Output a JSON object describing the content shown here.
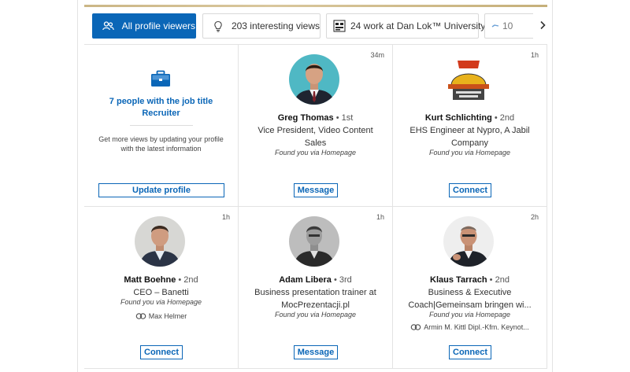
{
  "filters": [
    {
      "label": "All profile viewers",
      "icon": "people-icon",
      "active": true
    },
    {
      "label": "203 interesting views",
      "icon": "lightbulb-icon",
      "active": false
    },
    {
      "label": "24 work at Dan Lok™ University",
      "icon": "company-logo-icon",
      "active": false
    },
    {
      "label": "10",
      "icon": "chip-icon",
      "active": false
    }
  ],
  "filters_next_icon": "chevron-right-icon",
  "promo": {
    "title": "7 people with the job title Recruiter",
    "text": "Get more views by updating your profile with the latest information",
    "button": "Update profile",
    "icon": "briefcase-icon"
  },
  "viewers": [
    {
      "name": "Greg Thomas",
      "degree": "• 1st",
      "headline": "Vice President, Video Content Sales",
      "found": "Found you via Homepage",
      "time": "34m",
      "action": "Message",
      "mutual": ""
    },
    {
      "name": "Kurt Schlichting",
      "degree": "• 2nd",
      "headline": "EHS Engineer at Nypro, A Jabil Company",
      "found": "Found you via Homepage",
      "time": "1h",
      "action": "Connect",
      "mutual": ""
    },
    {
      "name": "Matt Boehne",
      "degree": "• 2nd",
      "headline": "CEO – Banetti",
      "found": "Found you via Homepage",
      "time": "1h",
      "action": "Connect",
      "mutual": "Max Helmer"
    },
    {
      "name": "Adam Libera",
      "degree": "• 3rd",
      "headline": "Business presentation trainer at MocPrezentacji.pl",
      "found": "Found you via Homepage",
      "time": "1h",
      "action": "Message",
      "mutual": ""
    },
    {
      "name": "Klaus Tarrach",
      "degree": "• 2nd",
      "headline": "Business & Executive Coach|Gemeinsam bringen wi...",
      "found": "Found you via Homepage",
      "time": "2h",
      "action": "Connect",
      "mutual": "Armin M. Kittl Dipl.-Kfm. Keynot..."
    }
  ],
  "colors": {
    "accent": "#0a66b7",
    "divider": "#e3e3e3"
  }
}
